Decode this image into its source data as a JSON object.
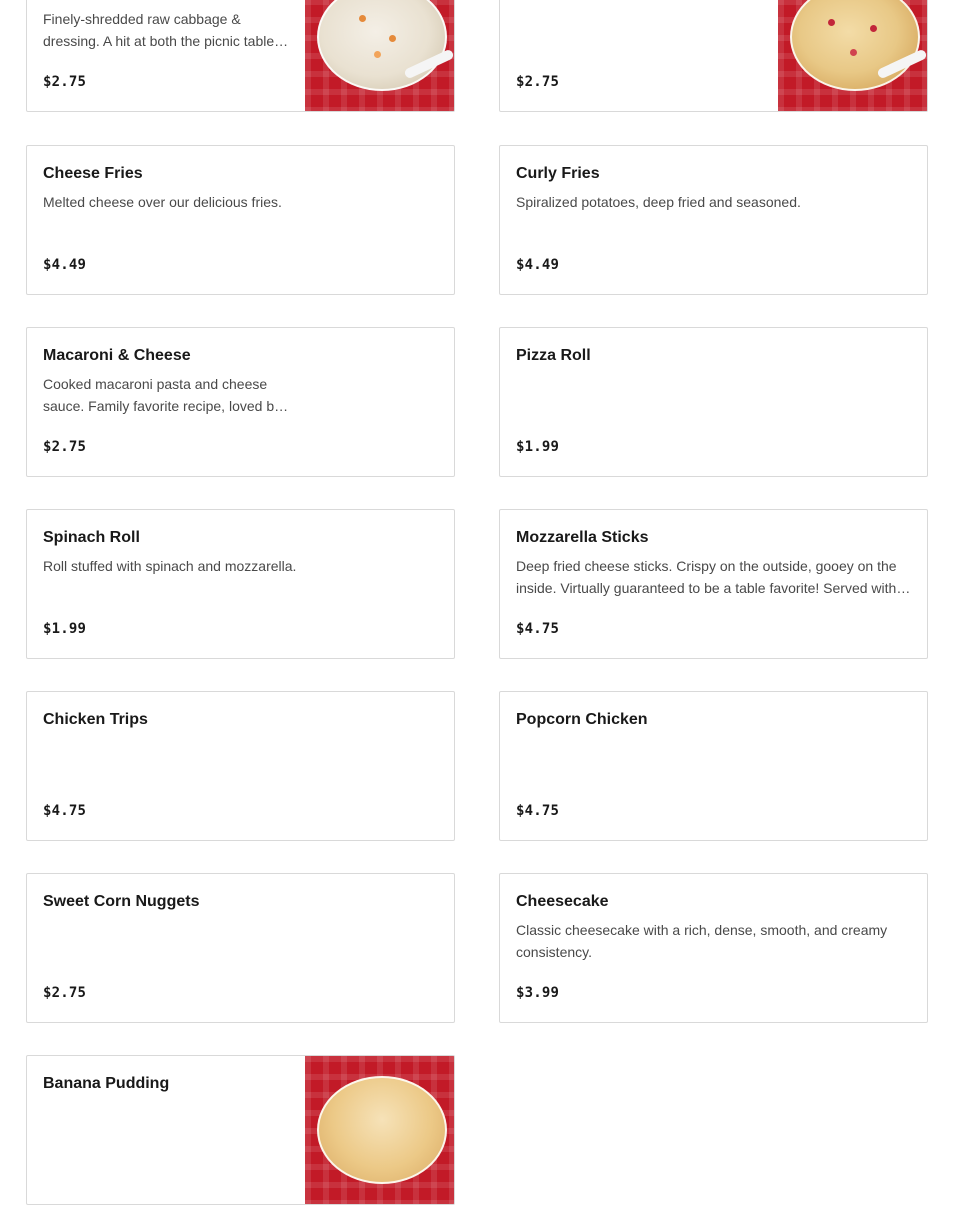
{
  "menu": {
    "items": [
      {
        "name": "",
        "description": "Finely-shredded raw cabbage & dressing. A hit at both the picnic table and dinner table.",
        "price": "$2.75",
        "image": "coleslaw-photo"
      },
      {
        "name": "",
        "description": "",
        "price": "$2.75",
        "image": "macaroni-salad-photo"
      },
      {
        "name": "Cheese Fries",
        "description": "Melted cheese over our delicious fries.",
        "price": "$4.49"
      },
      {
        "name": "Curly Fries",
        "description": "Spiralized potatoes, deep fried and seasoned.",
        "price": "$4.49"
      },
      {
        "name": "Macaroni & Cheese",
        "description": "Cooked macaroni pasta and cheese sauce. Family favorite recipe, loved by all.",
        "price": "$2.75"
      },
      {
        "name": "Pizza Roll",
        "description": "",
        "price": "$1.99"
      },
      {
        "name": "Spinach Roll",
        "description": "Roll stuffed with spinach and mozzarella.",
        "price": "$1.99"
      },
      {
        "name": "Mozzarella Sticks",
        "description": "Deep fried cheese sticks. Crispy on the outside, gooey on the inside. Virtually guaranteed to be a table favorite! Served with marinara sauce.",
        "price": "$4.75"
      },
      {
        "name": "Chicken Trips",
        "description": "",
        "price": "$4.75"
      },
      {
        "name": "Popcorn Chicken",
        "description": "",
        "price": "$4.75"
      },
      {
        "name": "Sweet Corn Nuggets",
        "description": "",
        "price": "$2.75"
      },
      {
        "name": "Cheesecake",
        "description": "Classic cheesecake with a rich, dense, smooth, and creamy consistency.",
        "price": "$3.99"
      },
      {
        "name": "Banana Pudding",
        "description": "",
        "price": "",
        "image": "banana-pudding-photo"
      }
    ]
  },
  "colors": {
    "card_border": "#d9d9d9",
    "title": "#191919",
    "description": "#494949",
    "photo_background": "#c21a27"
  }
}
